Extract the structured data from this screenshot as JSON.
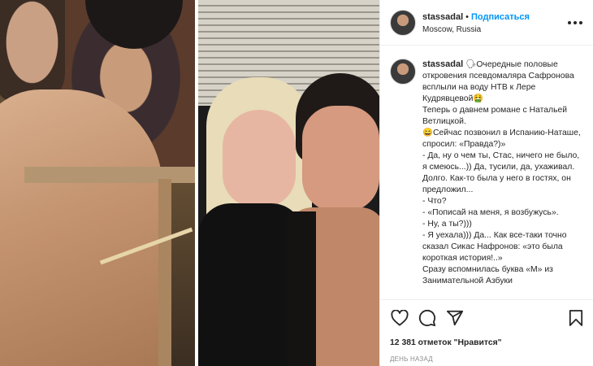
{
  "post": {
    "username": "stassadal",
    "dot": "•",
    "follow_label": "Подписаться",
    "location": "Moscow, Russia",
    "more_icon": "more-horizontal-icon"
  },
  "caption": {
    "username": "stassadal",
    "text": "🗣Очередные половые откровения псевдомаляра Сафронова всплыли на воду НТВ к Лере Кудрявцевой🤮\nТеперь о давнем романе с Натальей Ветлицкой.\n😄Сейчас позвонил в Испанию-Наташе, спросил: «Правда?)»\n- Да, ну о чем ты, Стас, ничего не было, я смеюсь...)) Да, тусили, да, ухаживал. Долго. Как-то была у него в гостях, он предложил...\n- Что?\n- «Пописай на меня, я возбужусь».\n- Ну, а ты?)))\n- Я уехала))) Да... Как все-таки точно сказал Сикас Нафронов: «это была короткая история!..»\nСразу вспомнилась буква «М» из Занимательной Азбуки"
  },
  "actions": {
    "like_icon": "heart-icon",
    "comment_icon": "comment-icon",
    "share_icon": "share-icon",
    "save_icon": "bookmark-icon"
  },
  "likes": "12 381 отметок \"Нравится\"",
  "timestamp": "ДЕНЬ НАЗАД",
  "colors": {
    "link": "#0095f6",
    "text": "#262626",
    "muted": "#8e8e8e",
    "border": "#efefef"
  }
}
